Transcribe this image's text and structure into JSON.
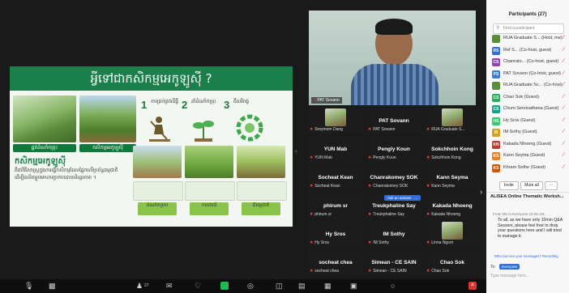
{
  "slide": {
    "title": "អ្វីទៅជាកសិកម្មអេកូឡូស៊ី ?",
    "steps": [
      {
        "num": "1",
        "text": "ការគ្រប់គ្រងដីធ្លី"
      },
      {
        "num": "2",
        "text": "ដាំដំណាំចម្រុះ"
      },
      {
        "num": "3",
        "text": "ជីសរីរាង្គ"
      }
    ],
    "captions": [
      "ផ្នត់ដំណាំចម្រុះ",
      "កសិកម្មអេកូឡូស៊ី",
      "ដំណាំគម្រប",
      "ការពារដី",
      "ជីធម្មជាតិ"
    ],
    "body_heading": "កសិកម្មអេកូឡូស៊ី",
    "body_text": "គឺជាវិធីសាស្ត្រក្នុងការធ្វើកសិកម្មដែលផ្អែកលើប្រព័ន្ធធម្មជាតិ ដើម្បីផលិតម្ហូបអាហារប្រកបដោយនិរន្តរភាព ។"
  },
  "speaker": {
    "name": "PAT Sovann"
  },
  "gallery": [
    {
      "name": "",
      "sub": "Sreymom Dang",
      "photo": true
    },
    {
      "name": "PAT Sovann",
      "sub": "PAT Sovann",
      "photo": false
    },
    {
      "name": "",
      "sub": "RUA Graduate S...",
      "photo": true
    },
    {
      "name": "YUN Mab",
      "sub": "YUN Mab",
      "photo": false
    },
    {
      "name": "Pengly Koun",
      "sub": "Pengly Koun",
      "photo": false
    },
    {
      "name": "Sokchhoin Kong",
      "sub": "Sokchhoin Kong",
      "photo": false
    },
    {
      "name": "Socheat Kean",
      "sub": "Socheat Kean",
      "photo": false
    },
    {
      "name": "Chanrakomey SOK",
      "sub": "Chanrakomey SOK",
      "photo": false
    },
    {
      "name": "Kann Seyma",
      "sub": "Kann Seyma",
      "photo": false
    },
    {
      "name": "phirum sr",
      "sub": "phirum sr",
      "photo": false
    },
    {
      "name": "Treukphaline Say",
      "sub": "Treukphaline Say",
      "photo": false
    },
    {
      "name": "Kakada Nhoeng",
      "sub": "Kakada Nhoeng",
      "photo": false
    },
    {
      "name": "Hy Sros",
      "sub": "Hy Sros",
      "photo": false
    },
    {
      "name": "IM Sothy",
      "sub": "IM Sothy",
      "photo": false
    },
    {
      "name": "",
      "sub": "Linna Ngorn",
      "photo": true
    },
    {
      "name": "socheat chea",
      "sub": "socheat chea",
      "photo": false
    },
    {
      "name": "Simean - CE SAIN",
      "sub": "Simean - CE SAIN",
      "photo": false
    },
    {
      "name": "Chao Sok",
      "sub": "Chao Sok",
      "photo": false
    }
  ],
  "ask_badge": "Ask an answer",
  "participants": {
    "header": "Participants (27)",
    "search_placeholder": "Find a participant",
    "rows": [
      {
        "initials": "",
        "name": "RUA Graduate S... (Host, me)",
        "color": "#5b8c3a"
      },
      {
        "initials": "RS",
        "name": "Ref S... (Co-host, guest)",
        "color": "#2f6fd6"
      },
      {
        "initials": "CS",
        "name": "Chanrato... (Co-host, guest)",
        "color": "#8e44ad"
      },
      {
        "initials": "PS",
        "name": "PAT Sovann (Co-host, guest)",
        "color": "#3a7bd5"
      },
      {
        "initials": "",
        "name": "RUA Graduate Sc... (Co-host)",
        "color": "#5b8c3a"
      },
      {
        "initials": "CS",
        "name": "Chao Sok (Guest)",
        "color": "#27ae60"
      },
      {
        "initials": "CS",
        "name": "Chum Sereivathana (Guest)",
        "color": "#16a085"
      },
      {
        "initials": "HS",
        "name": "Hy Sros (Guest)",
        "color": "#2ecc71"
      },
      {
        "initials": "IS",
        "name": "IM Sothy (Guest)",
        "color": "#d4a017"
      },
      {
        "initials": "KN",
        "name": "Kakada Nhoeng (Guest)",
        "color": "#c0392b"
      },
      {
        "initials": "KS",
        "name": "Kann Seyma (Guest)",
        "color": "#e67e22"
      },
      {
        "initials": "KS",
        "name": "Khram Sothe (Guest)",
        "color": "#d35400"
      }
    ],
    "invite_label": "Invite",
    "mute_all_label": "Mute all"
  },
  "chat": {
    "header": "ALISEA Online Thematic Worksh...",
    "from": "From Me to Everyone 10:25 AM",
    "message": "To all, as we have only 10min Q&A Session, please feel free to drop your questions here and I will tried to manage it.",
    "note": "Who can see your messages? Recording",
    "to_label": "To:",
    "to_value": "Everyone",
    "input_placeholder": "Type message here..."
  },
  "toolbar": {
    "participants_count": "27"
  }
}
